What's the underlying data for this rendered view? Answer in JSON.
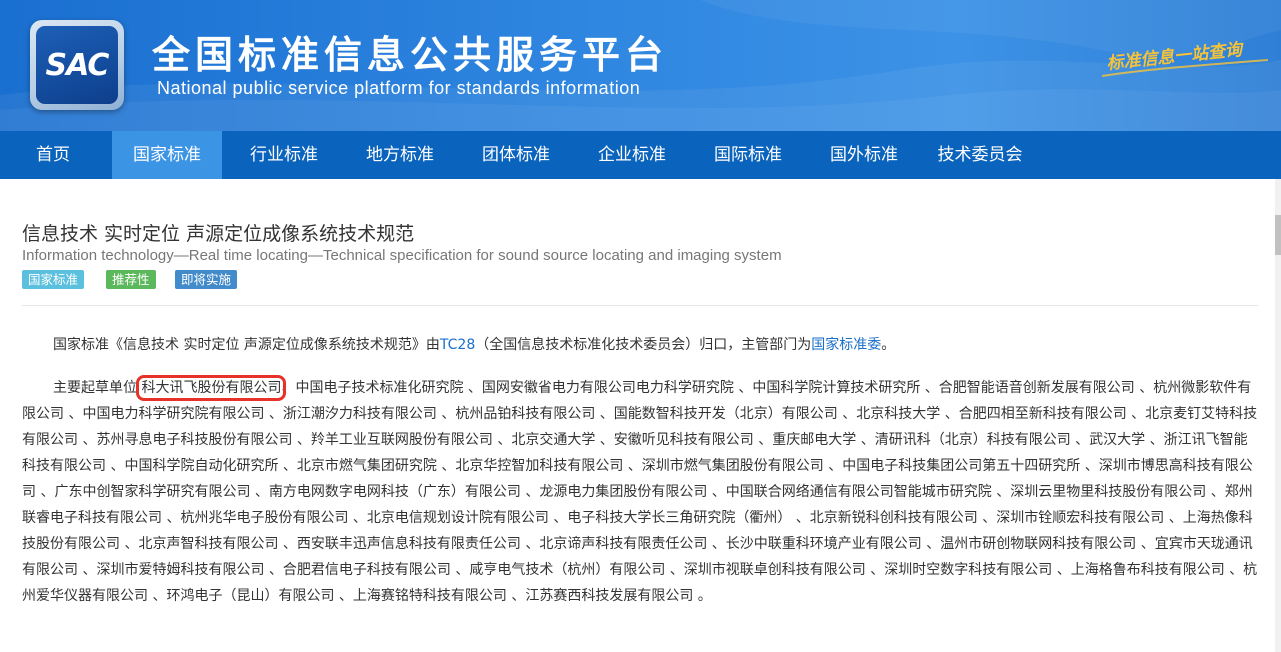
{
  "header": {
    "logo_text": "SAC",
    "title_cn": "全国标准信息公共服务平台",
    "title_en": "National public service platform  for standards information",
    "slogan": "标准信息一站查询"
  },
  "nav": {
    "items": [
      {
        "label": "首页"
      },
      {
        "label": "国家标准"
      },
      {
        "label": "行业标准"
      },
      {
        "label": "地方标准"
      },
      {
        "label": "团体标准"
      },
      {
        "label": "企业标准"
      },
      {
        "label": "国际标准"
      },
      {
        "label": "国外标准"
      },
      {
        "label": "技术委员会"
      }
    ],
    "active_index": 1
  },
  "standard": {
    "title_cn": "信息技术 实时定位 声源定位成像系统技术规范",
    "title_en": "Information technology—Real time locating—Technical specification for sound source locating and imaging system",
    "badges": [
      {
        "label": "国家标准",
        "color": "#5bc0de"
      },
      {
        "label": "推荐性",
        "color": "#5cb85c"
      },
      {
        "label": "即将实施",
        "color": "#428bca"
      }
    ]
  },
  "intro": {
    "prefix": "国家标准《信息技术 实时定位 声源定位成像系统技术规范》由",
    "tc_link": "TC28",
    "middle": "（全国信息技术标准化技术委员会）归口，主管部门为",
    "dept_link": "国家标准委",
    "suffix": "。"
  },
  "drafters": {
    "prefix": "主要起草单位 ",
    "highlighted": "科大讯飞股份有限公司",
    "rest": "、中国电子技术标准化研究院 、国网安徽省电力有限公司电力科学研究院 、中国科学院计算技术研究所 、合肥智能语音创新发展有限公司 、杭州微影软件有限公司 、中国电力科学研究院有限公司 、浙江潮汐力科技有限公司 、杭州品铂科技有限公司 、国能数智科技开发（北京）有限公司 、北京科技大学 、合肥四相至新科技有限公司 、北京麦钉艾特科技有限公司 、苏州寻息电子科技股份有限公司 、羚羊工业互联网股份有限公司 、北京交通大学 、安徽听见科技有限公司 、重庆邮电大学 、清研讯科（北京）科技有限公司 、武汉大学 、浙江讯飞智能科技有限公司 、中国科学院自动化研究所 、北京市燃气集团研究院 、北京华控智加科技有限公司 、深圳市燃气集团股份有限公司 、中国电子科技集团公司第五十四研究所 、深圳市博思高科技有限公司 、广东中创智家科学研究有限公司 、南方电网数字电网科技（广东）有限公司 、龙源电力集团股份有限公司 、中国联合网络通信有限公司智能城市研究院 、深圳云里物里科技股份有限公司 、郑州联睿电子科技有限公司 、杭州兆华电子股份有限公司 、北京电信规划设计院有限公司 、电子科技大学长三角研究院（衢州） 、北京新锐科创科技有限公司 、深圳市铨顺宏科技有限公司 、上海热像科技股份有限公司 、北京声智科技有限公司 、西安联丰迅声信息科技有限责任公司 、北京谛声科技有限责任公司 、长沙中联重科环境产业有限公司 、温州市研创物联网科技有限公司 、宜宾市天珑通讯有限公司 、深圳市爱特姆科技有限公司 、合肥君信电子科技有限公司 、咸亨电气技术（杭州）有限公司 、深圳市视联卓创科技有限公司 、深圳时空数字科技有限公司 、上海格鲁布科技有限公司 、杭州爱华仪器有限公司 、环鸿电子（昆山）有限公司 、上海赛铭特科技有限公司 、江苏赛西科技发展有限公司 。"
  }
}
